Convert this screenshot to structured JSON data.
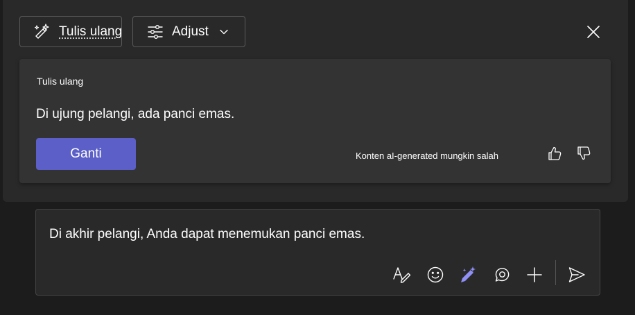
{
  "toolbar": {
    "rewrite_label": "Tulis ulang",
    "adjust_label": "Adjust"
  },
  "suggestion": {
    "title": "Tulis ulang",
    "text": "Di ujung pelangi, ada panci emas.",
    "replace_label": "Ganti",
    "disclaimer": "Konten aI-generated mungkin salah"
  },
  "compose": {
    "text": "Di akhir pelangi, Anda dapat menemukan panci emas."
  },
  "icons": {
    "rewrite": "sparkle-pen-icon",
    "adjust": "sliders-icon",
    "chevron": "chevron-down-icon",
    "close": "close-icon",
    "thumbs_up": "thumbs-up-icon",
    "thumbs_down": "thumbs-down-icon",
    "format": "format-text-icon",
    "emoji": "emoji-icon",
    "copilot": "copilot-pen-icon",
    "loop": "loop-icon",
    "add": "plus-icon",
    "send": "send-icon"
  },
  "colors": {
    "accent": "#5b5fc7",
    "copilot_icon": "#8f8ff5",
    "background": "#1c1c1c",
    "panel": "#292929",
    "card": "#333333"
  }
}
